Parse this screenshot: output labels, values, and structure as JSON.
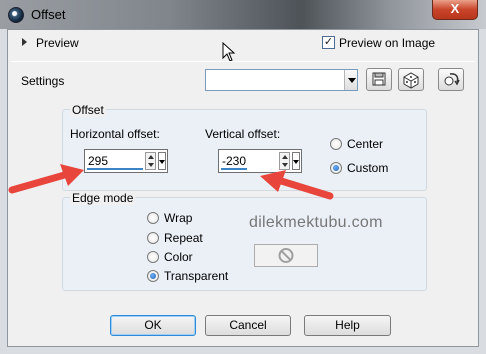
{
  "window": {
    "title": "Offset",
    "close_symbol": "X",
    "app_icon": "app-logo-icon"
  },
  "preview": {
    "label": "Preview",
    "preview_on_image_label": "Preview on Image",
    "preview_on_image_checked": true,
    "check_mark": "✓"
  },
  "settings": {
    "label": "Settings",
    "preset_value": "",
    "tools": [
      "save-preset-icon",
      "randomize-dice-icon",
      "reset-icon"
    ]
  },
  "offset": {
    "group_label": "Offset",
    "horizontal_label": "Horizontal offset:",
    "horizontal_value": "295",
    "vertical_label": "Vertical offset:",
    "vertical_value": "-230",
    "center_label": "Center",
    "custom_label": "Custom",
    "selected": "Custom"
  },
  "edge_mode": {
    "group_label": "Edge mode",
    "options": [
      "Wrap",
      "Repeat",
      "Color",
      "Transparent"
    ],
    "selected": "Transparent"
  },
  "watermark": "dilekmektubu.com",
  "buttons": {
    "ok": "OK",
    "cancel": "Cancel",
    "help": "Help"
  },
  "colors": {
    "close_button": "#c9452a",
    "annotation_arrow": "#e8453c",
    "accent_blue": "#3c84c5"
  }
}
